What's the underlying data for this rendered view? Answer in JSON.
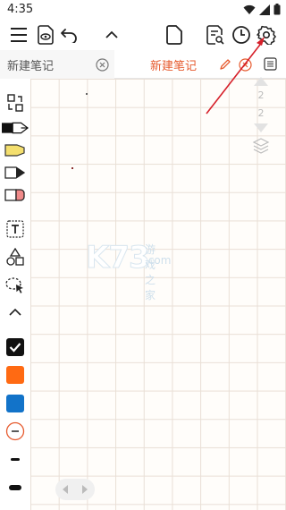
{
  "status_bar": {
    "time": "4:35"
  },
  "tabs": {
    "inactive_title": "新建笔记",
    "active_title": "新建笔记"
  },
  "page_nav": {
    "current": "2",
    "total": "2"
  },
  "watermark": {
    "logo": "K73",
    "cn": "游戏之家",
    "domain": ".com"
  },
  "colors": {
    "accent": "#e65a2e",
    "swatch_black": "#111111",
    "swatch_orange": "#ff6a13",
    "swatch_blue": "#1273c9",
    "annotation_arrow": "#d6202a"
  },
  "icons": {
    "toolbar": [
      "menu-icon",
      "preview-icon",
      "undo-icon",
      "collapse-icon",
      "new-page-icon",
      "search-doc-icon",
      "history-icon",
      "settings-icon"
    ],
    "sidebar": [
      "swap-icon",
      "pen-icon",
      "highlighter-icon",
      "brush-icon",
      "eraser-icon",
      "text-icon",
      "shapes-icon",
      "lasso-icon",
      "chevron-up-icon"
    ]
  }
}
